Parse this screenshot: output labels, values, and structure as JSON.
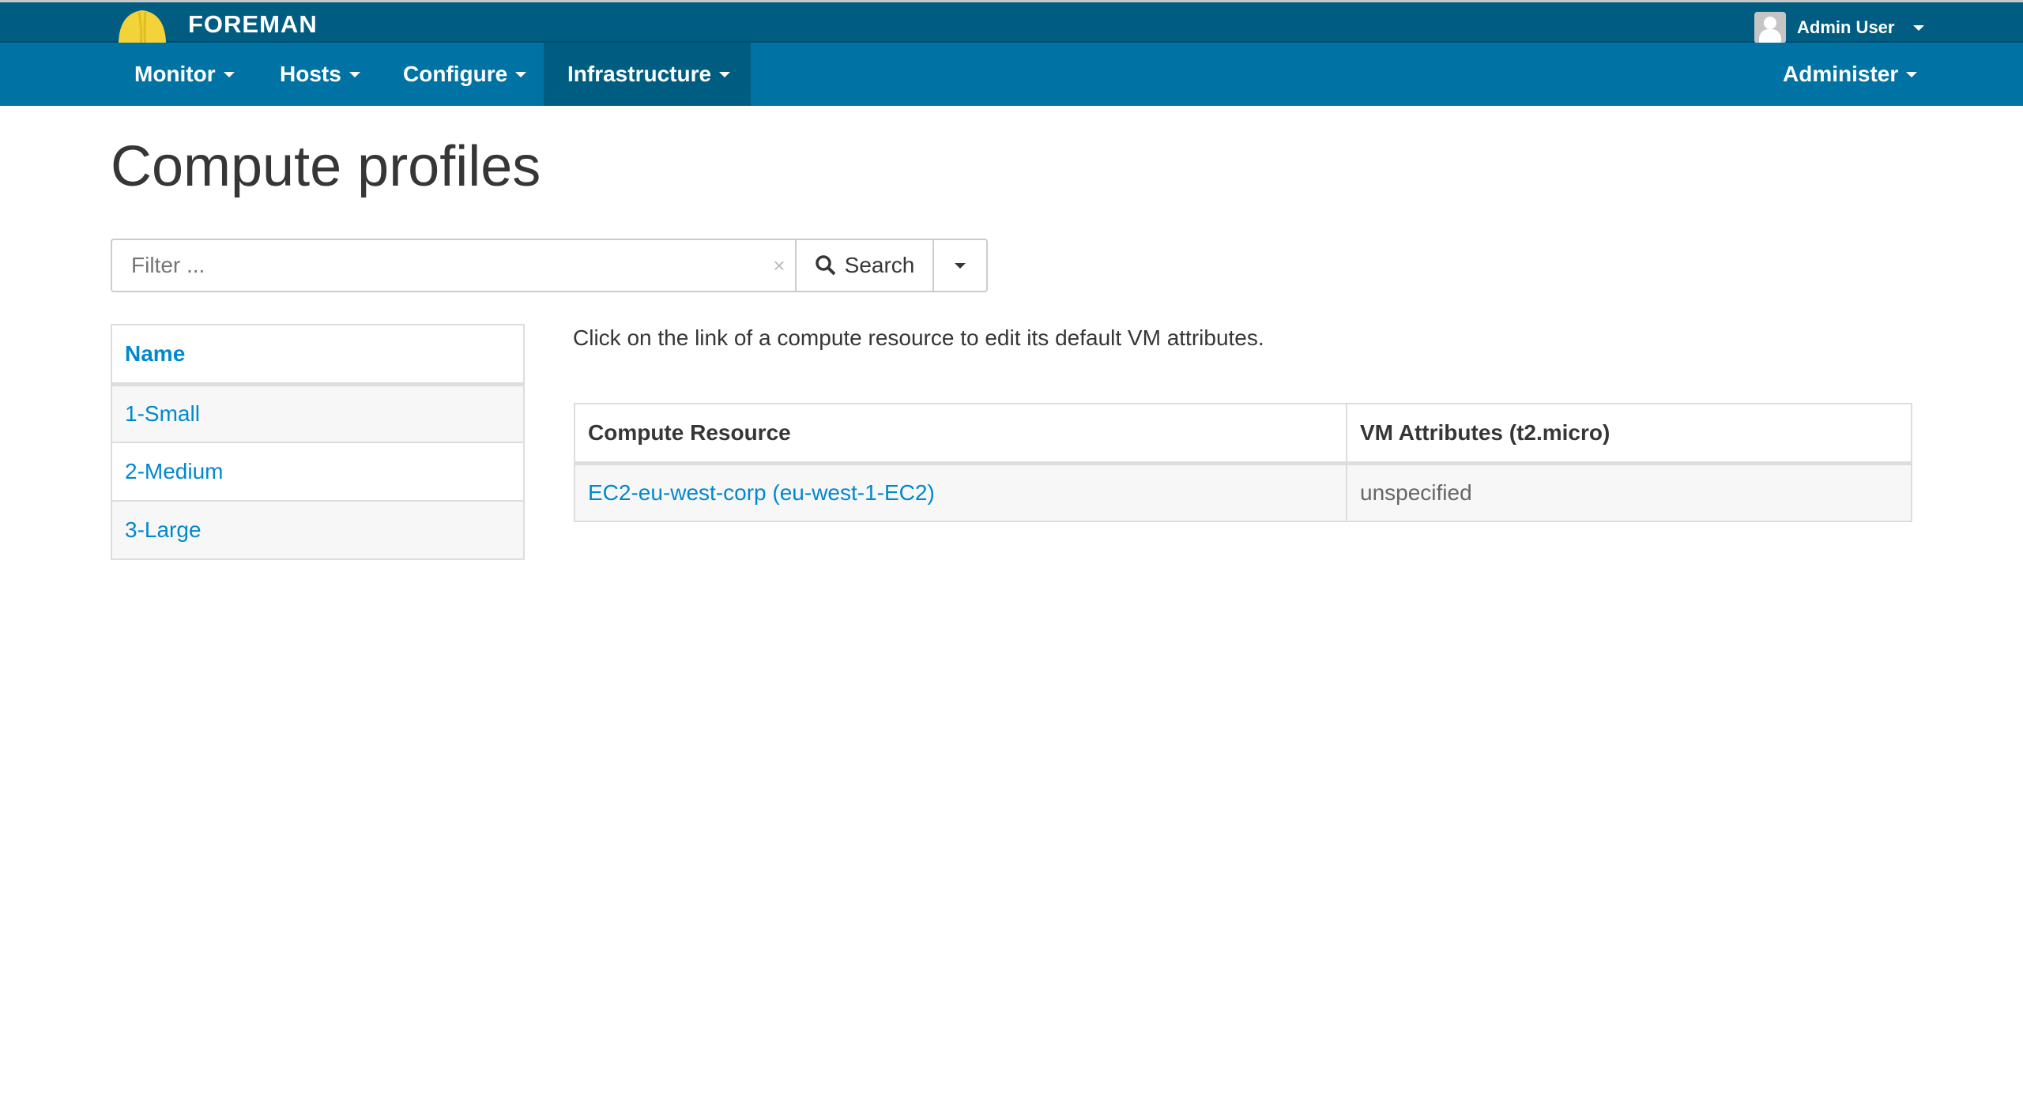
{
  "header": {
    "brand": "FOREMAN",
    "user": "Admin User"
  },
  "nav": {
    "items": [
      "Monitor",
      "Hosts",
      "Configure",
      "Infrastructure"
    ],
    "right": "Administer",
    "active": "Infrastructure"
  },
  "page": {
    "title": "Compute profiles"
  },
  "search": {
    "placeholder": "Filter ...",
    "clear": "×",
    "button": "Search"
  },
  "profiles": {
    "header": "Name",
    "rows": [
      "1-Small",
      "2-Medium",
      "3-Large"
    ]
  },
  "description": "Click on the link of a compute resource to edit its default VM attributes.",
  "resources": {
    "headers": [
      "Compute Resource",
      "VM Attributes (t2.micro)"
    ],
    "rows": [
      [
        "EC2-eu-west-corp (eu-west-1-EC2)",
        "unspecified"
      ]
    ]
  },
  "colors": {
    "topbar": "#005c80",
    "navbar": "#0073a4",
    "link": "#0088ce"
  }
}
